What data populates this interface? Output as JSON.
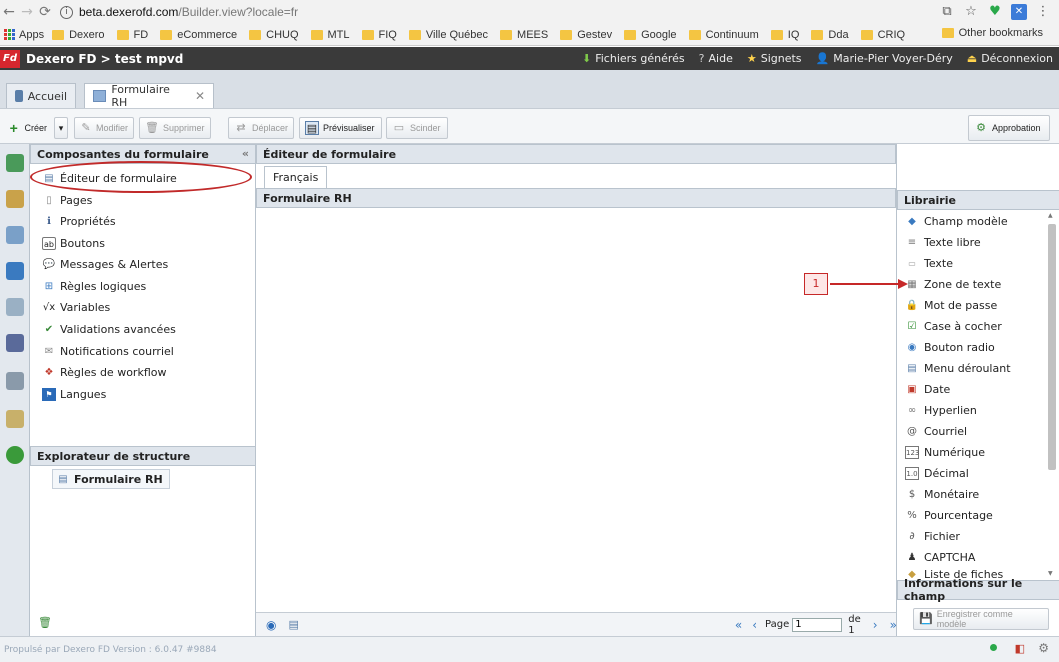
{
  "browser": {
    "url_host": "beta.dexerofd.com",
    "url_rest": "/Builder.view?locale=fr",
    "bookmarks": [
      "Apps",
      "Dexero",
      "FD",
      "eCommerce",
      "CHUQ",
      "MTL",
      "FIQ",
      "Ville Québec",
      "MEES",
      "Gestev",
      "Google",
      "Continuum",
      "IQ",
      "Dda",
      "CRIQ"
    ],
    "other_bookmarks": "Other bookmarks"
  },
  "header": {
    "logo_text": "Fd",
    "title": "Dexero FD > test mpvd",
    "links": [
      "Fichiers générés",
      "Aide",
      "Signets",
      "Marie-Pier Voyer-Déry",
      "Déconnexion"
    ]
  },
  "tabs": [
    {
      "label": "Accueil"
    },
    {
      "label": "Formulaire RH",
      "close": "✕"
    }
  ],
  "toolbar": {
    "create": "Créer",
    "modify": "Modifier",
    "delete": "Supprimer",
    "move": "Déplacer",
    "preview": "Prévisualiser",
    "split": "Scinder",
    "approval": "Approbation"
  },
  "left_panel": {
    "title": "Composantes du formulaire",
    "collapse": "«",
    "items": [
      "Éditeur de formulaire",
      "Pages",
      "Propriétés",
      "Boutons",
      "Messages & Alertes",
      "Règles logiques",
      "Variables",
      "Validations avancées",
      "Notifications courriel",
      "Règles de workflow",
      "Langues"
    ],
    "explorer_title": "Explorateur de structure",
    "explorer_item": "Formulaire RH"
  },
  "editor": {
    "title": "Éditeur de formulaire",
    "lang_tab": "Français",
    "form_title": "Formulaire RH",
    "pager": {
      "page_label": "Page",
      "page_value": "1",
      "of_label": "de 1"
    }
  },
  "library": {
    "title": "Librairie",
    "items": [
      "Champ modèle",
      "Texte libre",
      "Texte",
      "Zone de texte",
      "Mot de passe",
      "Case à cocher",
      "Bouton radio",
      "Menu déroulant",
      "Date",
      "Hyperlien",
      "Courriel",
      "Numérique",
      "Décimal",
      "Monétaire",
      "Pourcentage",
      "Fichier",
      "CAPTCHA",
      "Liste de fiches"
    ],
    "info_title": "Informations sur le champ",
    "save_model": "Enregistrer comme modèle"
  },
  "status": {
    "text": "Propulsé par Dexero FD Version : 6.0.47 #9884"
  },
  "annotation": {
    "label": "1"
  },
  "colors": {
    "accent_red": "#c62828",
    "header_bg": "#3a3a3a",
    "panel_bg": "#dfe5ec"
  }
}
